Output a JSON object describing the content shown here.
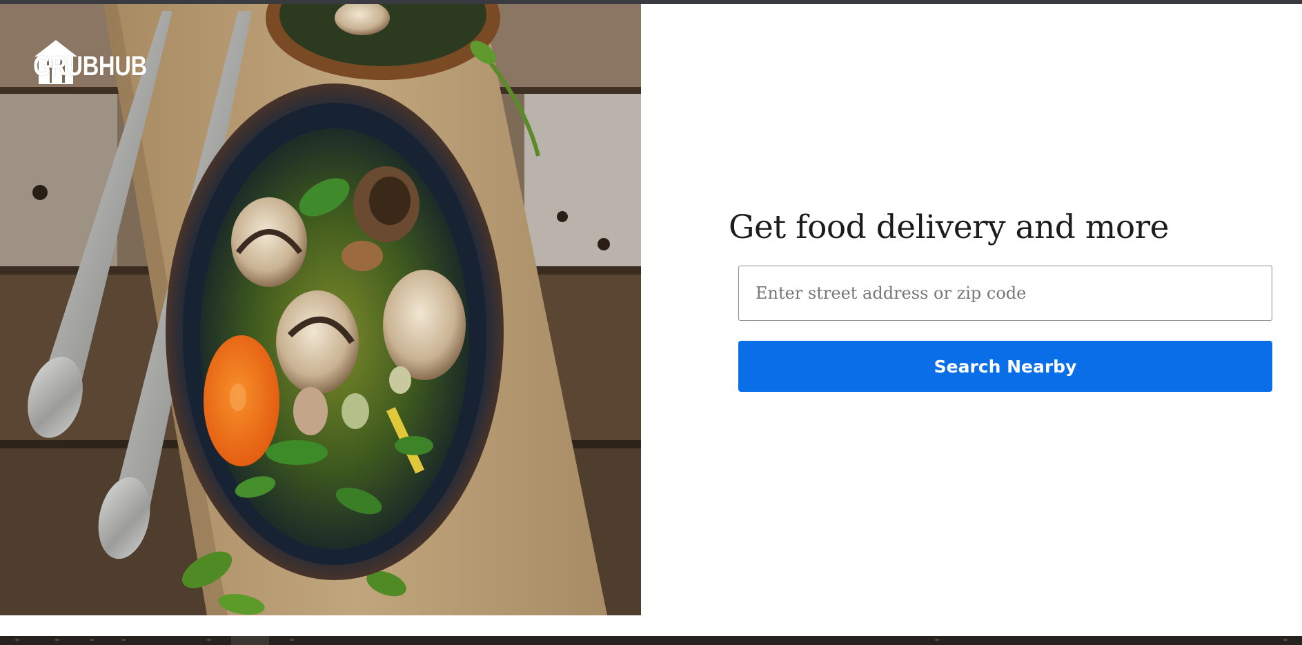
{
  "brand": {
    "name": "GRUBHUB",
    "logo_icon": "grubhub-house-fork-icon"
  },
  "hero": {
    "image_alt": "Bowl of mushroom and carrot soup on a wooden board"
  },
  "main": {
    "headline": "Get food delivery and more",
    "address_input": {
      "value": "",
      "placeholder": "Enter street address or zip code"
    },
    "search_button_label": "Search Nearby"
  },
  "colors": {
    "primary_button": "#0a6ee8",
    "headline_text": "#1c1c1c",
    "input_border": "#8a8a8a",
    "logo_text": "#ffffff"
  }
}
